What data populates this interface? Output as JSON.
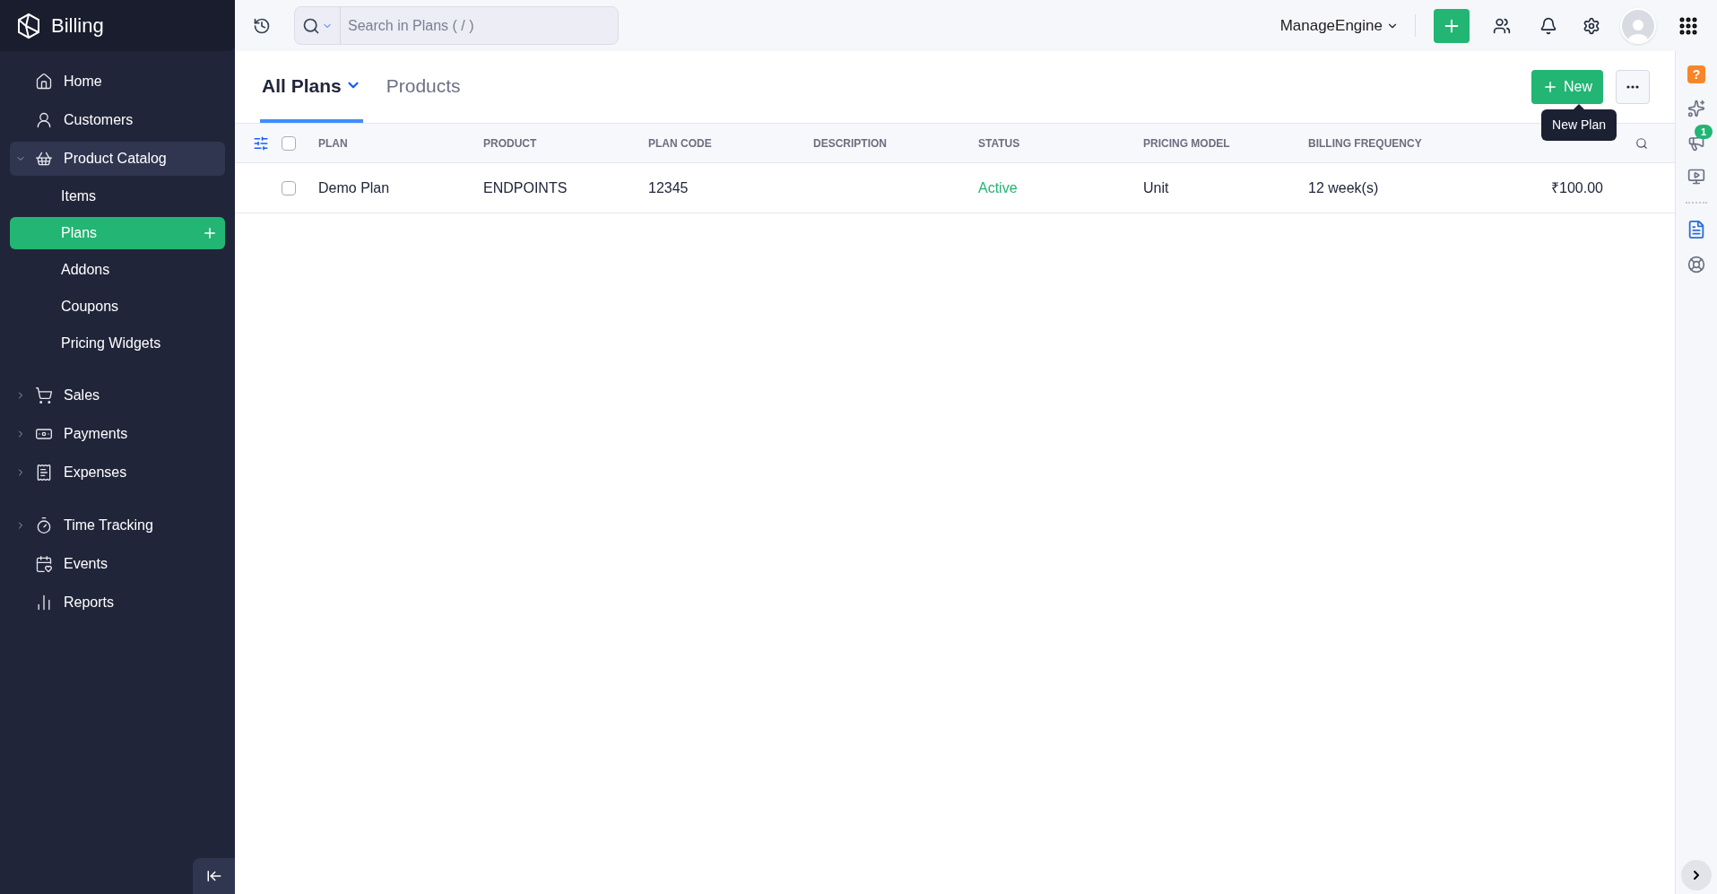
{
  "sidebar": {
    "brand": "Billing",
    "items": [
      {
        "label": "Home",
        "selected": false
      },
      {
        "label": "Customers",
        "selected": false
      },
      {
        "label": "Product Catalog",
        "selected": true,
        "expanded": true,
        "children": [
          {
            "label": "Items",
            "selected": false
          },
          {
            "label": "Plans",
            "selected": true
          },
          {
            "label": "Addons",
            "selected": false
          },
          {
            "label": "Coupons",
            "selected": false
          },
          {
            "label": "Pricing Widgets",
            "selected": false
          }
        ]
      },
      {
        "label": "Sales",
        "selected": false,
        "expanded": false
      },
      {
        "label": "Payments",
        "selected": false,
        "expanded": false
      },
      {
        "label": "Expenses",
        "selected": false,
        "expanded": false
      },
      {
        "label": "Time Tracking",
        "selected": false,
        "expanded": false
      },
      {
        "label": "Events",
        "selected": false
      },
      {
        "label": "Reports",
        "selected": false
      }
    ]
  },
  "topbar": {
    "search": {
      "placeholder": "Search in Plans ( / )"
    },
    "organization": "ManageEngine"
  },
  "views": [
    {
      "label": "All Plans",
      "selected": true
    },
    {
      "label": "Products",
      "selected": false
    }
  ],
  "new_button": "New",
  "tooltip": "New Plan",
  "table": {
    "select_all_checked": false,
    "columns": [
      {
        "label": "PLAN",
        "kind": "text"
      },
      {
        "label": "PRODUCT",
        "kind": "text"
      },
      {
        "label": "PLAN CODE",
        "kind": "text"
      },
      {
        "label": "DESCRIPTION",
        "kind": "text"
      },
      {
        "label": "STATUS",
        "kind": "status"
      },
      {
        "label": "PRICING MODEL",
        "kind": "text"
      },
      {
        "label": "BILLING FREQUENCY",
        "kind": "text"
      },
      {
        "kind": "amount"
      }
    ],
    "rows": [
      {
        "checked": false,
        "cells": [
          "Demo Plan",
          "ENDPOINTS",
          "12345",
          "",
          "Active",
          "Unit",
          "12 week(s)",
          "₹100.00"
        ]
      }
    ]
  },
  "right_rail": {
    "help": "?",
    "badge": "1"
  }
}
